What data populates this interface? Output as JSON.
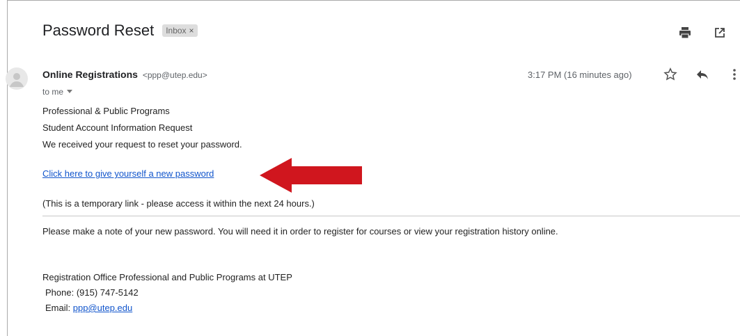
{
  "email": {
    "subject": "Password Reset",
    "label_chip": "Inbox",
    "label_chip_close": "×",
    "sender_name": "Online Registrations",
    "sender_email": "<ppp@utep.edu>",
    "recipient": "to me",
    "timestamp": "3:17 PM (16 minutes ago)"
  },
  "body": {
    "line1": "Professional & Public Programs",
    "line2": "Student Account Information Request",
    "line3": "We received your request to reset your password.",
    "reset_link": "Click here to give yourself a new password",
    "temp_note": "(This is a temporary link - please access it within the next 24 hours.)",
    "note": "Please make a note of your new password. You will need it in order to register for courses or view your registration history online.",
    "signature_office": "Registration Office Professional and Public Programs at UTEP",
    "signature_phone": "Phone: (915) 747-5142",
    "signature_email_label": "Email: ",
    "signature_email": "ppp@utep.edu"
  },
  "icons": {
    "print": "print-icon",
    "open_new_window": "open-in-new-icon",
    "star": "star-icon",
    "reply": "reply-icon",
    "more": "more-vert-icon",
    "avatar": "person-icon",
    "dropdown": "caret-down-icon"
  },
  "colors": {
    "annotation_arrow": "#d0161e",
    "link": "#1155cc"
  }
}
